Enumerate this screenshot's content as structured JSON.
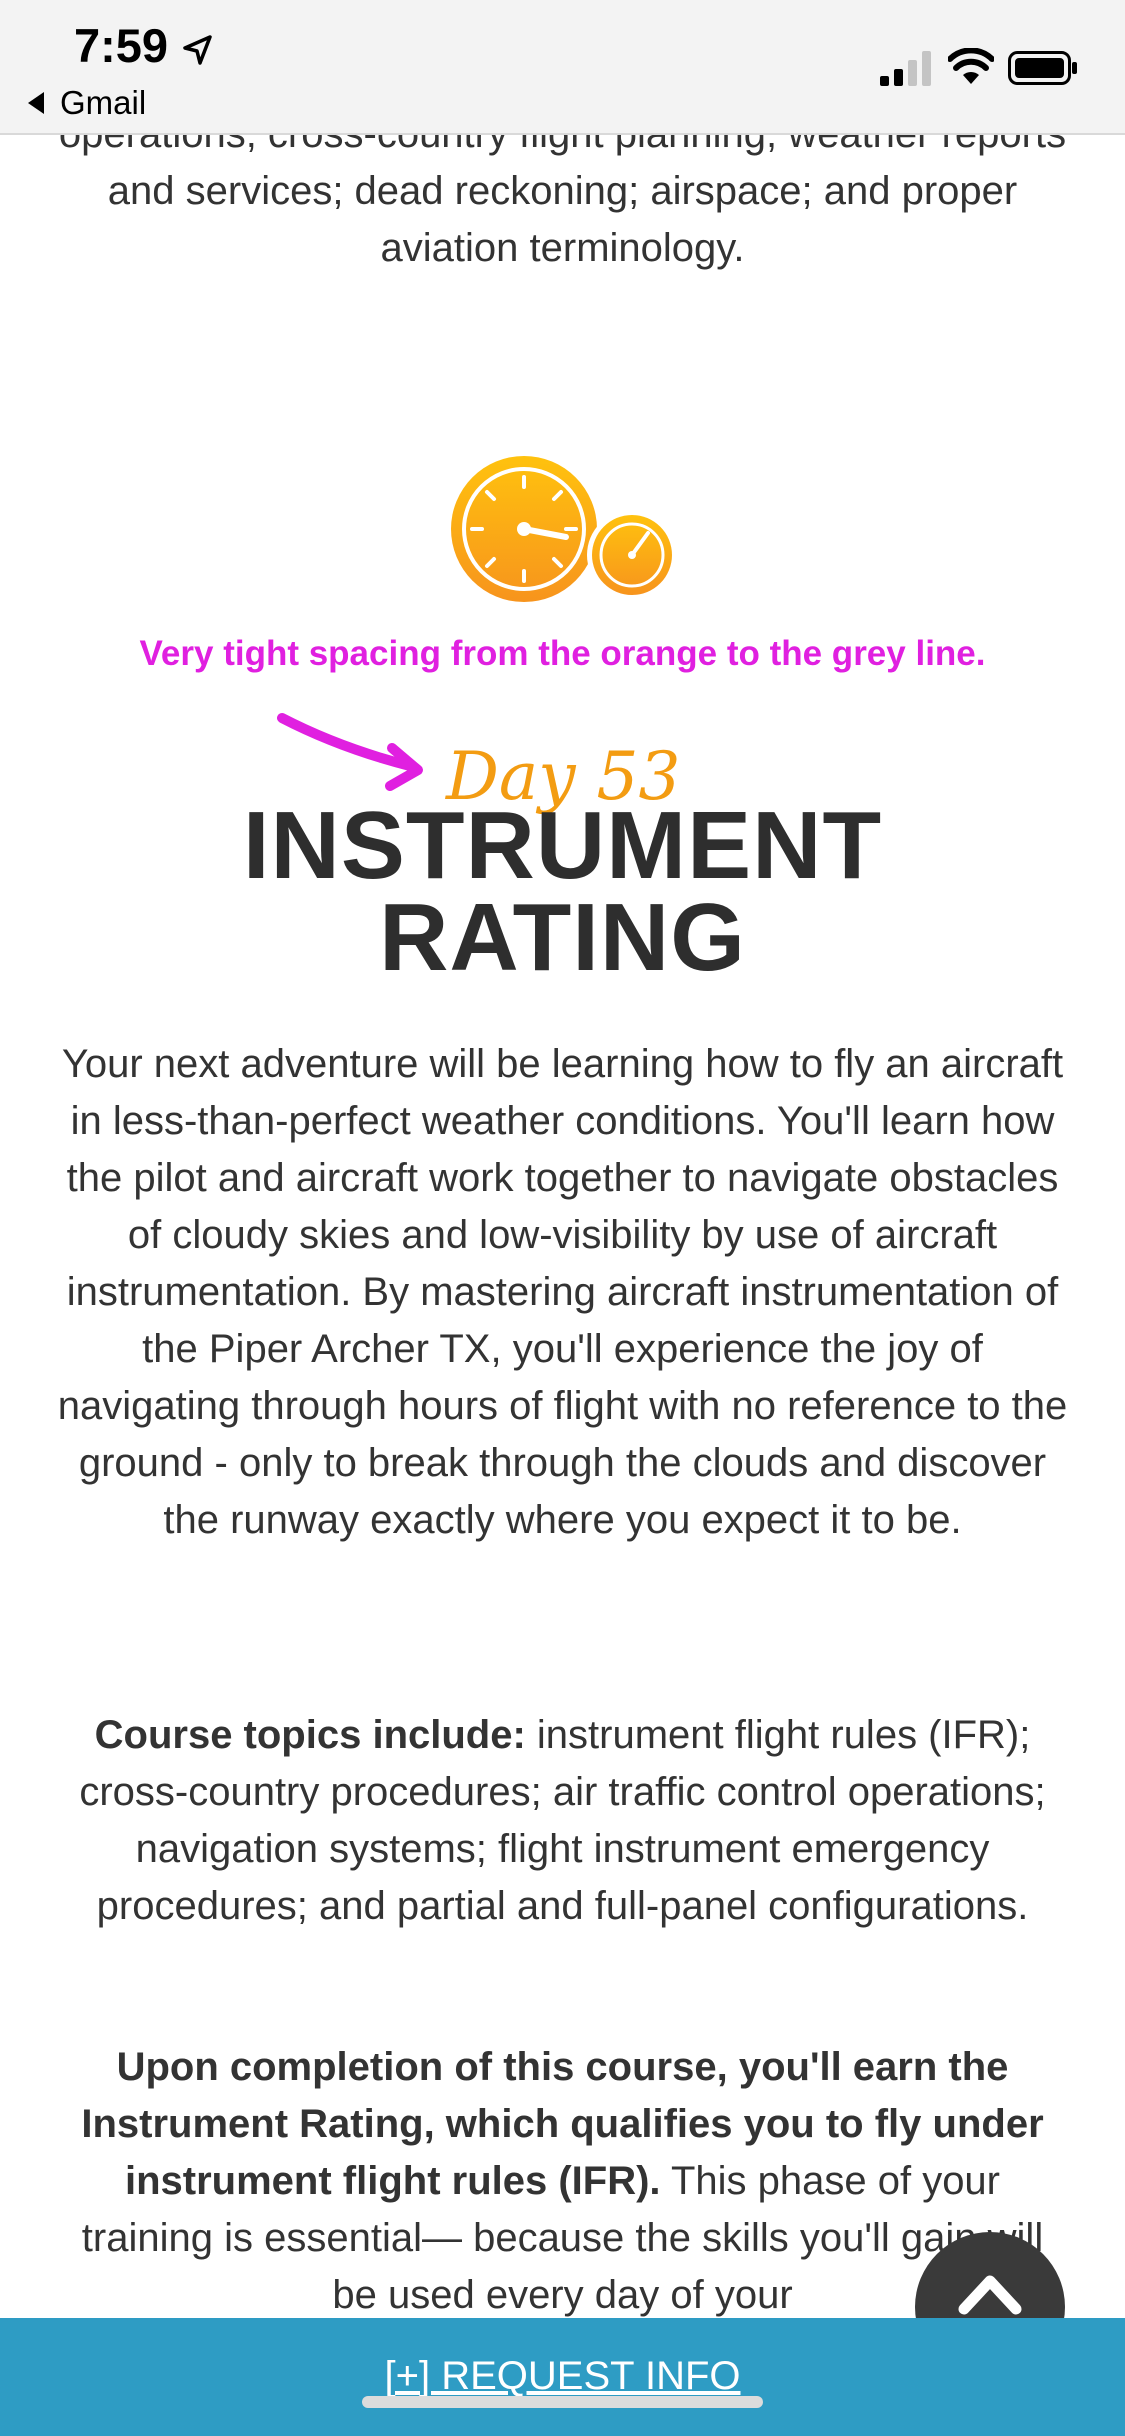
{
  "status_bar": {
    "time": "7:59",
    "back_app": "Gmail"
  },
  "content": {
    "top_paragraph": "operations; cross-country flight planning; weather reports and services; dead reckoning; airspace; and proper aviation terminology.",
    "annotation": "Very tight spacing from the orange to the grey line.",
    "day_label": "Day 53",
    "title_line1": "INSTRUMENT",
    "title_line2": "RATING",
    "description": "Your next adventure will be learning how to fly an aircraft in less-than-perfect weather conditions. You'll learn how the pilot and aircraft work together to navigate obstacles of cloudy skies and low-visibility by use of aircraft instrumentation. By mastering aircraft instrumentation of the Piper Archer TX, you'll experience the joy of navigating through hours of flight with no reference to the ground - only to break through the clouds and discover the runway exactly where you expect it to be.",
    "topics_label": "Course topics include:",
    "topics_text": " instrument flight rules (IFR); cross-country procedures; air traffic control operations; navigation systems; flight instrument emergency procedures; and partial and full-panel configurations.",
    "completion_bold": "Upon completion of this course, you'll earn the Instrument Rating, which qualifies you to fly under instrument flight rules (IFR).",
    "completion_text": " This phase of your training is essential— because the skills you'll gain will be used every day of your"
  },
  "footer": {
    "request_label": "[+] REQUEST INFO"
  },
  "icons": {
    "gauge": "gauge-icon",
    "scroll_top": "chevron-up-icon",
    "annotation_arrow": "arrow-icon"
  },
  "colors": {
    "accent_orange": "#f39c12",
    "annotation_magenta": "#e020e0",
    "request_bar": "#2e9cc4",
    "title": "#2e2e2e"
  }
}
